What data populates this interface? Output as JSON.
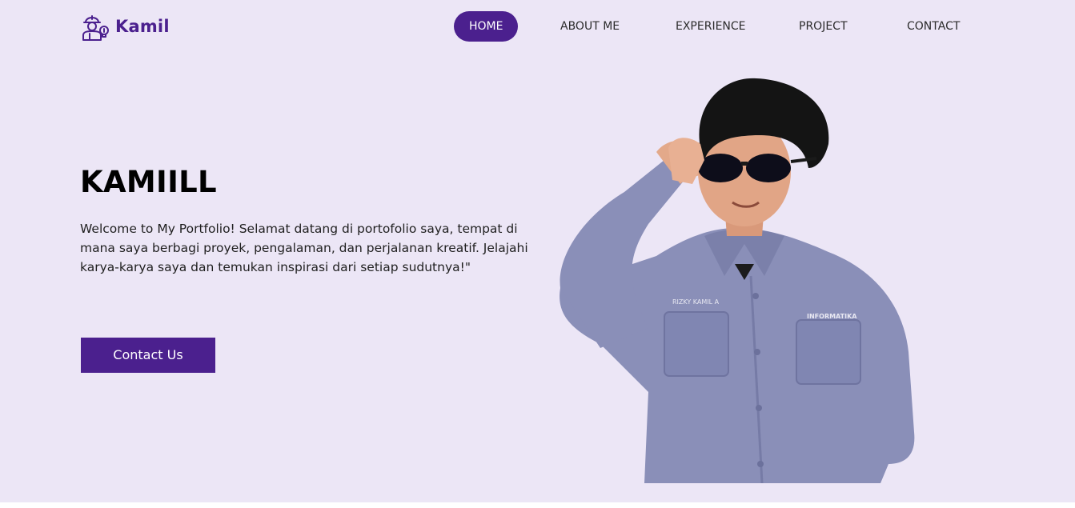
{
  "brand": {
    "name": "Kamil",
    "icon": "engineer-avatar-icon"
  },
  "nav": {
    "items": [
      {
        "label": "HOME",
        "active": true
      },
      {
        "label": "ABOUT ME",
        "active": false
      },
      {
        "label": "EXPERIENCE",
        "active": false
      },
      {
        "label": "PROJECT",
        "active": false
      },
      {
        "label": "CONTACT",
        "active": false
      }
    ]
  },
  "hero": {
    "title": "KAMIILL",
    "text": "Welcome to My Portfolio! Selamat datang di portofolio saya, tempat di mana saya berbagi proyek, pengalaman, dan perjalanan kreatif. Jelajahi karya-karya saya dan temukan inspirasi dari setiap sudutnya!\"",
    "cta_label": "Contact Us"
  },
  "portrait": {
    "shirt_name_tag": "RIZKY KAMIL A",
    "shirt_badge": "INFORMATIKA"
  },
  "colors": {
    "accent": "#4b208e",
    "background": "#ece6f6",
    "shirt": "#8a8fb8"
  }
}
